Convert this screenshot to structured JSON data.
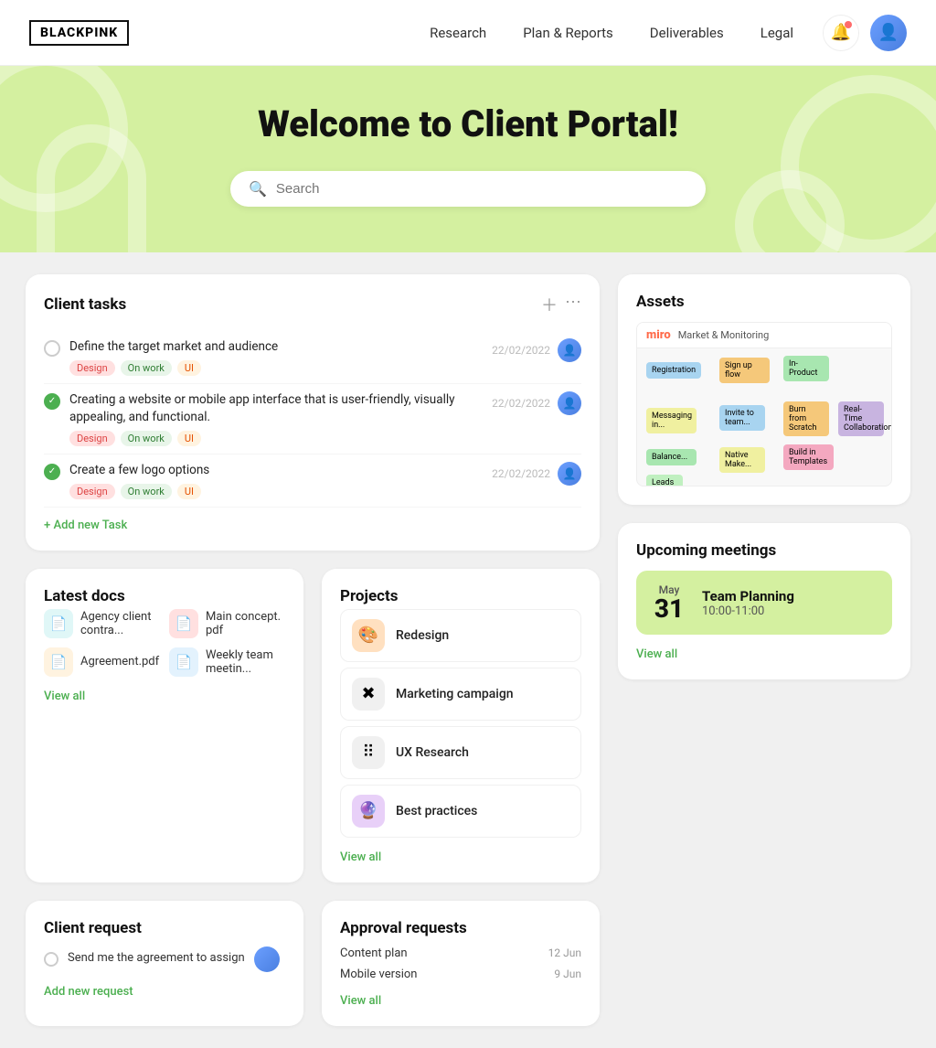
{
  "navbar": {
    "logo": "BLACKPINK",
    "links": [
      {
        "label": "Research",
        "id": "research"
      },
      {
        "label": "Plan & Reports",
        "id": "plan-reports"
      },
      {
        "label": "Deliverables",
        "id": "deliverables"
      },
      {
        "label": "Legal",
        "id": "legal"
      }
    ]
  },
  "hero": {
    "title": "Welcome to Client Portal!",
    "search_placeholder": "Search"
  },
  "client_tasks": {
    "title": "Client tasks",
    "tasks": [
      {
        "text": "Define the target market and audience",
        "done": false,
        "tags": [
          "Design",
          "On work",
          "UI"
        ],
        "date": "22/02/2022"
      },
      {
        "text": "Creating a website or mobile app interface that is user-friendly, visually appealing, and functional.",
        "done": true,
        "tags": [
          "Design",
          "On work",
          "UI"
        ],
        "date": "22/02/2022"
      },
      {
        "text": "Create a few logo options",
        "done": true,
        "tags": [
          "Design",
          "On work",
          "UI"
        ],
        "date": "22/02/2022"
      }
    ],
    "add_task_label": "+ Add new Task"
  },
  "latest_docs": {
    "title": "Latest docs",
    "docs": [
      {
        "name": "Agency client contra...",
        "color": "teal",
        "icon": "📄"
      },
      {
        "name": "Main concept. pdf",
        "color": "red",
        "icon": "📄"
      },
      {
        "name": "Agreement.pdf",
        "color": "orange",
        "icon": "📄"
      },
      {
        "name": "Weekly team meetin...",
        "color": "blue",
        "icon": "📄"
      }
    ],
    "view_all": "View all"
  },
  "client_request": {
    "title": "Client request",
    "request_text": "Send me the agreement to assign",
    "add_label": "Add new request"
  },
  "approval_requests": {
    "title": "Approval requests",
    "items": [
      {
        "name": "Content plan",
        "date": "12 Jun"
      },
      {
        "name": "Mobile version",
        "date": "9 Jun"
      }
    ],
    "view_all": "View all"
  },
  "assets": {
    "title": "Assets"
  },
  "projects": {
    "title": "Projects",
    "items": [
      {
        "name": "Redesign",
        "icon": "🎨",
        "color": "#ffe0c0"
      },
      {
        "name": "Marketing campaign",
        "icon": "✖",
        "color": "#f0f0f0"
      },
      {
        "name": "UX Research",
        "icon": "⠿",
        "color": "#f0f0f0"
      },
      {
        "name": "Best practices",
        "icon": "🔮",
        "color": "#e8d0f8"
      }
    ],
    "view_all": "View all"
  },
  "upcoming_meetings": {
    "title": "Upcoming meetings",
    "meeting": {
      "month": "May",
      "day": "31",
      "title": "Team Planning",
      "time": "10:00-11:00"
    },
    "view_all": "View all"
  }
}
